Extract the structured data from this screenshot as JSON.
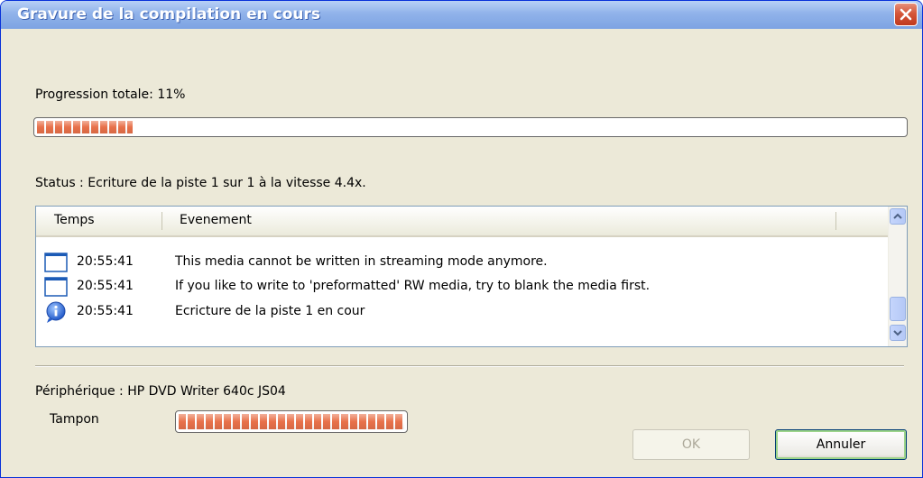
{
  "window": {
    "title": "Gravure de la compilation en cours"
  },
  "progress": {
    "label": "Progression totale: 11%",
    "value_percent": 11
  },
  "status": {
    "text": "Status : Ecriture de la piste 1 sur 1 à la vitesse 4.4x."
  },
  "log": {
    "columns": [
      "Temps",
      "Evenement"
    ],
    "rows": [
      {
        "icon": "message-icon",
        "time": "20:55:41",
        "event": "This media cannot be written in streaming mode anymore."
      },
      {
        "icon": "message-icon",
        "time": "20:55:41",
        "event": "If you like to write to 'preformatted' RW media, try to blank the media first."
      },
      {
        "icon": "info-icon",
        "time": "20:55:41",
        "event": "Ecricture de la piste 1 en cour"
      }
    ]
  },
  "device": {
    "label": "Périphérique : HP DVD Writer 640c JS04"
  },
  "buffer": {
    "label": "Tampon",
    "value_percent": 100
  },
  "buttons": {
    "ok": "OK",
    "cancel": "Annuler"
  },
  "colors": {
    "titlebar": "#91b3ea",
    "progress_fill": "#e8714a",
    "close_button": "#d5573a"
  }
}
